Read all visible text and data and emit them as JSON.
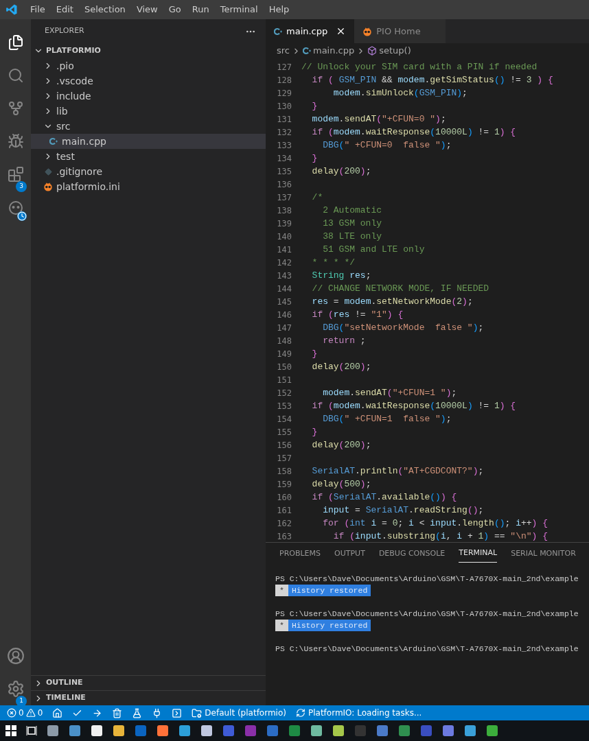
{
  "menu": [
    "File",
    "Edit",
    "Selection",
    "View",
    "Go",
    "Run",
    "Terminal",
    "Help"
  ],
  "activity_bar": {
    "extensions_badge": "3",
    "settings_badge": "1"
  },
  "sidebar": {
    "title": "EXPLORER",
    "section": {
      "title": "PLATFORMIO",
      "expanded": true,
      "items": [
        {
          "label": ".pio",
          "kind": "folder",
          "expanded": false,
          "selected": false
        },
        {
          "label": ".vscode",
          "kind": "folder",
          "expanded": false,
          "selected": false
        },
        {
          "label": "include",
          "kind": "folder",
          "expanded": false,
          "selected": false
        },
        {
          "label": "lib",
          "kind": "folder",
          "expanded": false,
          "selected": false
        },
        {
          "label": "src",
          "kind": "folder",
          "expanded": true,
          "selected": false,
          "children": [
            {
              "label": "main.cpp",
              "kind": "cpp",
              "selected": true
            }
          ]
        },
        {
          "label": "test",
          "kind": "folder",
          "expanded": false,
          "selected": false
        },
        {
          "label": ".gitignore",
          "kind": "git",
          "selected": false
        },
        {
          "label": "platformio.ini",
          "kind": "pio",
          "selected": false
        }
      ]
    },
    "bottom_sections": [
      {
        "title": "OUTLINE",
        "expanded": false
      },
      {
        "title": "TIMELINE",
        "expanded": false
      }
    ]
  },
  "editor": {
    "tabs": [
      {
        "label": "main.cpp",
        "kind": "cpp",
        "selected": true
      },
      {
        "label": "PIO Home",
        "kind": "pio",
        "selected": false
      }
    ],
    "breadcrumb": [
      {
        "label": "src",
        "kind": "folder"
      },
      {
        "label": "main.cpp",
        "kind": "cpp"
      },
      {
        "label": "setup()",
        "kind": "method"
      }
    ],
    "lines": [
      {
        "number": "127",
        "tokens": [
          {
            "text": "// Unlock your SIM card with a PIN if needed",
            "kind": "comment"
          }
        ]
      },
      {
        "number": "128",
        "tokens": [
          {
            "text": "  if",
            "kind": "keyword"
          },
          {
            "text": " (",
            "kind": "bracket1"
          },
          {
            "text": " GSM_PIN",
            "kind": "macro"
          },
          {
            "text": " &&",
            "kind": "plain"
          },
          {
            "text": " modem",
            "kind": "variable"
          },
          {
            "text": ".",
            "kind": "plain"
          },
          {
            "text": "getSimStatus",
            "kind": "function"
          },
          {
            "text": "()",
            "kind": "bracket2"
          },
          {
            "text": " !=",
            "kind": "plain"
          },
          {
            "text": " 3",
            "kind": "number"
          },
          {
            "text": " )",
            "kind": "bracket1"
          },
          {
            "text": " {",
            "kind": "bracket1"
          }
        ]
      },
      {
        "number": "129",
        "tokens": [
          {
            "text": "      modem",
            "kind": "variable"
          },
          {
            "text": ".",
            "kind": "plain"
          },
          {
            "text": "simUnlock",
            "kind": "function"
          },
          {
            "text": "(",
            "kind": "bracket2"
          },
          {
            "text": "GSM_PIN",
            "kind": "macro"
          },
          {
            "text": ")",
            "kind": "bracket2"
          },
          {
            "text": ";",
            "kind": "plain"
          }
        ]
      },
      {
        "number": "130",
        "tokens": [
          {
            "text": "  }",
            "kind": "bracket1"
          }
        ]
      },
      {
        "number": "131",
        "tokens": [
          {
            "text": "  modem",
            "kind": "variable"
          },
          {
            "text": ".",
            "kind": "plain"
          },
          {
            "text": "sendAT",
            "kind": "function"
          },
          {
            "text": "(",
            "kind": "bracket1"
          },
          {
            "text": "\"+CFUN=0 \"",
            "kind": "string"
          },
          {
            "text": ")",
            "kind": "bracket1"
          },
          {
            "text": ";",
            "kind": "plain"
          }
        ]
      },
      {
        "number": "132",
        "tokens": [
          {
            "text": "  if",
            "kind": "keyword"
          },
          {
            "text": " (",
            "kind": "bracket1"
          },
          {
            "text": "modem",
            "kind": "variable"
          },
          {
            "text": ".",
            "kind": "plain"
          },
          {
            "text": "waitResponse",
            "kind": "function"
          },
          {
            "text": "(",
            "kind": "bracket2"
          },
          {
            "text": "10000L",
            "kind": "number"
          },
          {
            "text": ")",
            "kind": "bracket2"
          },
          {
            "text": " !=",
            "kind": "plain"
          },
          {
            "text": " 1",
            "kind": "number"
          },
          {
            "text": ")",
            "kind": "bracket1"
          },
          {
            "text": " {",
            "kind": "bracket1"
          }
        ]
      },
      {
        "number": "133",
        "tokens": [
          {
            "text": "    DBG",
            "kind": "macro"
          },
          {
            "text": "(",
            "kind": "bracket2"
          },
          {
            "text": "\" +CFUN=0  false \"",
            "kind": "string"
          },
          {
            "text": ")",
            "kind": "bracket2"
          },
          {
            "text": ";",
            "kind": "plain"
          }
        ]
      },
      {
        "number": "134",
        "tokens": [
          {
            "text": "  }",
            "kind": "bracket1"
          }
        ]
      },
      {
        "number": "135",
        "tokens": [
          {
            "text": "  delay",
            "kind": "function"
          },
          {
            "text": "(",
            "kind": "bracket1"
          },
          {
            "text": "200",
            "kind": "number"
          },
          {
            "text": ")",
            "kind": "bracket1"
          },
          {
            "text": ";",
            "kind": "plain"
          }
        ]
      },
      {
        "number": "136"
      },
      {
        "number": "137",
        "tokens": [
          {
            "text": "  /*",
            "kind": "comment"
          }
        ]
      },
      {
        "number": "138",
        "tokens": [
          {
            "text": "    2 Automatic",
            "kind": "comment"
          }
        ]
      },
      {
        "number": "139",
        "tokens": [
          {
            "text": "    13 GSM only",
            "kind": "comment"
          }
        ]
      },
      {
        "number": "140",
        "tokens": [
          {
            "text": "    38 LTE only",
            "kind": "comment"
          }
        ]
      },
      {
        "number": "141",
        "tokens": [
          {
            "text": "    51 GSM and LTE only",
            "kind": "comment"
          }
        ]
      },
      {
        "number": "142",
        "tokens": [
          {
            "text": "  * * * */",
            "kind": "comment"
          }
        ]
      },
      {
        "number": "143",
        "tokens": [
          {
            "text": "  String",
            "kind": "type"
          },
          {
            "text": " res",
            "kind": "variable"
          },
          {
            "text": ";",
            "kind": "plain"
          }
        ]
      },
      {
        "number": "144",
        "tokens": [
          {
            "text": "  // CHANGE NETWORK MODE, IF NEEDED",
            "kind": "comment"
          }
        ]
      },
      {
        "number": "145",
        "tokens": [
          {
            "text": "  res",
            "kind": "variable"
          },
          {
            "text": " =",
            "kind": "plain"
          },
          {
            "text": " modem",
            "kind": "variable"
          },
          {
            "text": ".",
            "kind": "plain"
          },
          {
            "text": "setNetworkMode",
            "kind": "function"
          },
          {
            "text": "(",
            "kind": "bracket1"
          },
          {
            "text": "2",
            "kind": "number"
          },
          {
            "text": ")",
            "kind": "bracket1"
          },
          {
            "text": ";",
            "kind": "plain"
          }
        ]
      },
      {
        "number": "146",
        "tokens": [
          {
            "text": "  if",
            "kind": "keyword"
          },
          {
            "text": " (",
            "kind": "bracket1"
          },
          {
            "text": "res",
            "kind": "variable"
          },
          {
            "text": " !=",
            "kind": "plain"
          },
          {
            "text": " \"1\"",
            "kind": "string"
          },
          {
            "text": ")",
            "kind": "bracket1"
          },
          {
            "text": " {",
            "kind": "bracket1"
          }
        ]
      },
      {
        "number": "147",
        "tokens": [
          {
            "text": "    DBG",
            "kind": "macro"
          },
          {
            "text": "(",
            "kind": "bracket2"
          },
          {
            "text": "\"setNetworkMode  false \"",
            "kind": "string"
          },
          {
            "text": ")",
            "kind": "bracket2"
          },
          {
            "text": ";",
            "kind": "plain"
          }
        ]
      },
      {
        "number": "148",
        "tokens": [
          {
            "text": "    return",
            "kind": "keyword"
          },
          {
            "text": " ;",
            "kind": "plain"
          }
        ]
      },
      {
        "number": "149",
        "tokens": [
          {
            "text": "  }",
            "kind": "bracket1"
          }
        ]
      },
      {
        "number": "150",
        "tokens": [
          {
            "text": "  delay",
            "kind": "function"
          },
          {
            "text": "(",
            "kind": "bracket1"
          },
          {
            "text": "200",
            "kind": "number"
          },
          {
            "text": ")",
            "kind": "bracket1"
          },
          {
            "text": ";",
            "kind": "plain"
          }
        ]
      },
      {
        "number": "151"
      },
      {
        "number": "152",
        "tokens": [
          {
            "text": "    modem",
            "kind": "variable"
          },
          {
            "text": ".",
            "kind": "plain"
          },
          {
            "text": "sendAT",
            "kind": "function"
          },
          {
            "text": "(",
            "kind": "bracket1"
          },
          {
            "text": "\"+CFUN=1 \"",
            "kind": "string"
          },
          {
            "text": ")",
            "kind": "bracket1"
          },
          {
            "text": ";",
            "kind": "plain"
          }
        ]
      },
      {
        "number": "153",
        "tokens": [
          {
            "text": "  if",
            "kind": "keyword"
          },
          {
            "text": " (",
            "kind": "bracket1"
          },
          {
            "text": "modem",
            "kind": "variable"
          },
          {
            "text": ".",
            "kind": "plain"
          },
          {
            "text": "waitResponse",
            "kind": "function"
          },
          {
            "text": "(",
            "kind": "bracket2"
          },
          {
            "text": "10000L",
            "kind": "number"
          },
          {
            "text": ")",
            "kind": "bracket2"
          },
          {
            "text": " !=",
            "kind": "plain"
          },
          {
            "text": " 1",
            "kind": "number"
          },
          {
            "text": ")",
            "kind": "bracket1"
          },
          {
            "text": " {",
            "kind": "bracket1"
          }
        ]
      },
      {
        "number": "154",
        "tokens": [
          {
            "text": "    DBG",
            "kind": "macro"
          },
          {
            "text": "(",
            "kind": "bracket2"
          },
          {
            "text": "\" +CFUN=1  false \"",
            "kind": "string"
          },
          {
            "text": ")",
            "kind": "bracket2"
          },
          {
            "text": ";",
            "kind": "plain"
          }
        ]
      },
      {
        "number": "155",
        "tokens": [
          {
            "text": "  }",
            "kind": "bracket1"
          }
        ]
      },
      {
        "number": "156",
        "tokens": [
          {
            "text": "  delay",
            "kind": "function"
          },
          {
            "text": "(",
            "kind": "bracket1"
          },
          {
            "text": "200",
            "kind": "number"
          },
          {
            "text": ")",
            "kind": "bracket1"
          },
          {
            "text": ";",
            "kind": "plain"
          }
        ]
      },
      {
        "number": "157"
      },
      {
        "number": "158",
        "tokens": [
          {
            "text": "  SerialAT",
            "kind": "macro"
          },
          {
            "text": ".",
            "kind": "plain"
          },
          {
            "text": "println",
            "kind": "function"
          },
          {
            "text": "(",
            "kind": "bracket1"
          },
          {
            "text": "\"AT+CGDCONT?\"",
            "kind": "string"
          },
          {
            "text": ")",
            "kind": "bracket1"
          },
          {
            "text": ";",
            "kind": "plain"
          }
        ]
      },
      {
        "number": "159",
        "tokens": [
          {
            "text": "  delay",
            "kind": "function"
          },
          {
            "text": "(",
            "kind": "bracket1"
          },
          {
            "text": "500",
            "kind": "number"
          },
          {
            "text": ")",
            "kind": "bracket1"
          },
          {
            "text": ";",
            "kind": "plain"
          }
        ]
      },
      {
        "number": "160",
        "tokens": [
          {
            "text": "  if",
            "kind": "keyword"
          },
          {
            "text": " (",
            "kind": "bracket1"
          },
          {
            "text": "SerialAT",
            "kind": "macro"
          },
          {
            "text": ".",
            "kind": "plain"
          },
          {
            "text": "available",
            "kind": "function"
          },
          {
            "text": "()",
            "kind": "bracket2"
          },
          {
            "text": ")",
            "kind": "bracket1"
          },
          {
            "text": " {",
            "kind": "bracket1"
          }
        ]
      },
      {
        "number": "161",
        "tokens": [
          {
            "text": "    input",
            "kind": "variable"
          },
          {
            "text": " =",
            "kind": "plain"
          },
          {
            "text": " SerialAT",
            "kind": "macro"
          },
          {
            "text": ".",
            "kind": "plain"
          },
          {
            "text": "readString",
            "kind": "function"
          },
          {
            "text": "()",
            "kind": "bracket1"
          },
          {
            "text": ";",
            "kind": "plain"
          }
        ]
      },
      {
        "number": "162",
        "tokens": [
          {
            "text": "    for",
            "kind": "keyword"
          },
          {
            "text": " (",
            "kind": "bracket1"
          },
          {
            "text": "int",
            "kind": "macro"
          },
          {
            "text": " i",
            "kind": "variable"
          },
          {
            "text": " =",
            "kind": "plain"
          },
          {
            "text": " 0",
            "kind": "number"
          },
          {
            "text": ";",
            "kind": "plain"
          },
          {
            "text": " i",
            "kind": "variable"
          },
          {
            "text": " <",
            "kind": "plain"
          },
          {
            "text": " input",
            "kind": "variable"
          },
          {
            "text": ".",
            "kind": "plain"
          },
          {
            "text": "length",
            "kind": "function"
          },
          {
            "text": "()",
            "kind": "bracket2"
          },
          {
            "text": ";",
            "kind": "plain"
          },
          {
            "text": " i",
            "kind": "variable"
          },
          {
            "text": "++",
            "kind": "plain"
          },
          {
            "text": ")",
            "kind": "bracket1"
          },
          {
            "text": " {",
            "kind": "bracket1"
          }
        ]
      },
      {
        "number": "163",
        "tokens": [
          {
            "text": "      if",
            "kind": "keyword"
          },
          {
            "text": " (",
            "kind": "bracket1"
          },
          {
            "text": "input",
            "kind": "variable"
          },
          {
            "text": ".",
            "kind": "plain"
          },
          {
            "text": "substring",
            "kind": "function"
          },
          {
            "text": "(",
            "kind": "bracket2"
          },
          {
            "text": "i",
            "kind": "variable"
          },
          {
            "text": ",",
            "kind": "plain"
          },
          {
            "text": " i",
            "kind": "variable"
          },
          {
            "text": " +",
            "kind": "plain"
          },
          {
            "text": " 1",
            "kind": "number"
          },
          {
            "text": ")",
            "kind": "bracket2"
          },
          {
            "text": " ==",
            "kind": "plain"
          },
          {
            "text": " \"\\n\"",
            "kind": "string"
          },
          {
            "text": ")",
            "kind": "bracket1"
          },
          {
            "text": " {",
            "kind": "bracket1"
          }
        ]
      }
    ]
  },
  "panel": {
    "tabs": [
      {
        "label": "PROBLEMS",
        "selected": false
      },
      {
        "label": "OUTPUT",
        "selected": false
      },
      {
        "label": "DEBUG CONSOLE",
        "selected": false
      },
      {
        "label": "TERMINAL",
        "selected": true
      },
      {
        "label": "SERIAL MONITOR",
        "selected": false
      }
    ],
    "terminal": [
      {
        "kind": "prompt",
        "text": "PS C:\\Users\\Dave\\Documents\\Arduino\\GSM\\T-A7670X-main_2nd\\example"
      },
      {
        "kind": "notice",
        "mark": "*",
        "text": "History restored"
      },
      {
        "kind": "prompt",
        "text": "PS C:\\Users\\Dave\\Documents\\Arduino\\GSM\\T-A7670X-main_2nd\\example"
      },
      {
        "kind": "notice",
        "mark": "*",
        "text": "History restored"
      },
      {
        "kind": "prompt",
        "text": "PS C:\\Users\\Dave\\Documents\\Arduino\\GSM\\T-A7670X-main_2nd\\example"
      }
    ]
  },
  "status_bar": {
    "errors": "0",
    "warnings": "0",
    "environment": "Default (platformio)",
    "task": "PlatformIO: Loading tasks..."
  }
}
